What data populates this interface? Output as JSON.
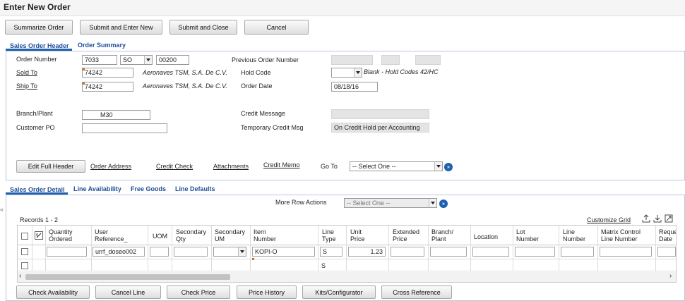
{
  "window": {
    "title": "Enter New Order"
  },
  "toolbar": {
    "summarize": "Summarize Order",
    "submit_enter": "Submit and Enter New",
    "submit_close": "Submit and Close",
    "cancel": "Cancel"
  },
  "header_tabs": [
    "Sales Order Header",
    "Order Summary"
  ],
  "header": {
    "order_number_label": "Order Number",
    "order_number": "7033",
    "order_type": "SO",
    "order_company": "00200",
    "previous_order_label": "Previous Order Number",
    "sold_to_label": "Sold To",
    "sold_to": "74242",
    "sold_to_name": "Aeronaves TSM, S.A. De C.V.",
    "hold_code_label": "Hold Code",
    "hold_code_desc": "Blank - Hold Codes 42/HC",
    "ship_to_label": "Ship To",
    "ship_to": "74242",
    "ship_to_name": "Aeronaves TSM, S.A. De C.V.",
    "order_date_label": "Order Date",
    "order_date": "08/18/16",
    "branch_label": "Branch/Plant",
    "branch": "M30",
    "credit_message_label": "Credit Message",
    "customer_po_label": "Customer PO",
    "temp_credit_label": "Temporary Credit Msg",
    "temp_credit_value": "On Credit Hold per Accounting"
  },
  "header_actions": {
    "edit_full_header": "Edit Full Header",
    "order_address": "Order Address",
    "credit_check": "Credit Check",
    "attachments": "Attachments",
    "credit_memo": "Credit Memo",
    "goto_label": "Go To",
    "goto_select": "-- Select One --"
  },
  "detail_tabs": [
    "Sales Order Detail",
    "Line Availability",
    "Free Goods",
    "Line Defaults"
  ],
  "detail": {
    "more_row_actions_label": "More Row Actions",
    "more_row_actions_select": "-- Select One --",
    "records": "Records 1 - 2",
    "customize_grid": "Customize Grid",
    "columns": [
      "Quantity\nOrdered",
      "User\nReference_",
      "UOM",
      "Secondary\nQty",
      "Secondary\nUM",
      "Item\nNumber",
      "Line\nType",
      "Unit\nPrice",
      "Extended\nPrice",
      "Branch/\nPlant",
      "Location",
      "Lot\nNumber",
      "Line\nNumber",
      "Matrix Control\nLine Number",
      "Reque\nDate"
    ],
    "row1": {
      "user_reference": "urrf_doseo002",
      "item_number": "KOPI-O",
      "line_type": "S",
      "unit_price": "1.23"
    },
    "row2": {
      "line_type": "S"
    }
  },
  "bottom_buttons": {
    "check_availability": "Check Availability",
    "cancel_line": "Cancel Line",
    "check_price": "Check Price",
    "price_history": "Price History",
    "kits": "Kits/Configurator",
    "cross_reference": "Cross Reference"
  },
  "icons": {
    "go": "go-arrow-icon",
    "export": "export-icon",
    "import": "import-icon",
    "maximize": "maximize-grid-icon",
    "collapse": "collapse-sidebar-icon"
  },
  "colors": {
    "accent": "#1f5fae",
    "required_marker": "#e06a0c"
  }
}
